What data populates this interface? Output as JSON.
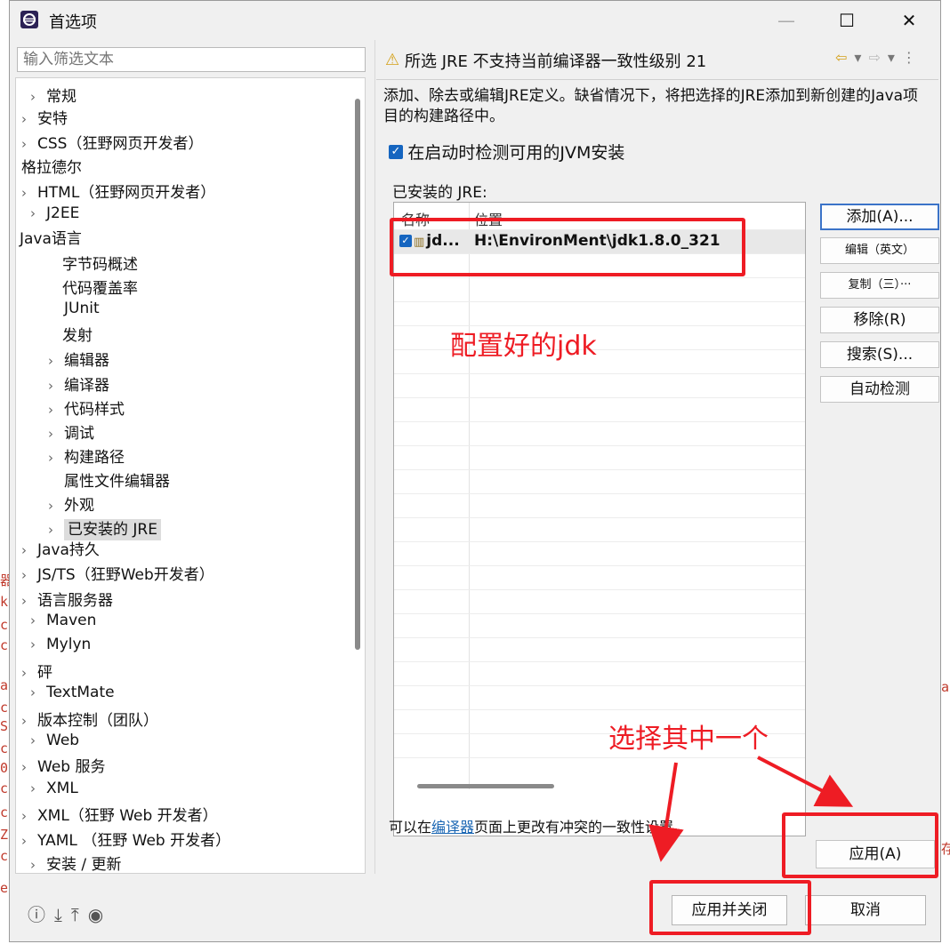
{
  "window": {
    "title": "首选项",
    "minimize": "—",
    "maximize": "☐",
    "close": "✕"
  },
  "filter": {
    "placeholder": "输入筛选文本"
  },
  "tree": {
    "items": [
      {
        "label": "常规",
        "chevron": true
      },
      {
        "label": "安特",
        "chevron": true
      },
      {
        "label": "CSS（狂野网页开发者）",
        "chevron": true
      },
      {
        "label": "格拉德尔",
        "chevron": false
      },
      {
        "label": "HTML（狂野网页开发者）",
        "chevron": true
      },
      {
        "label": "J2EE",
        "chevron": true
      },
      {
        "label": "Java语言",
        "chevron": false
      },
      {
        "label": "字节码概述",
        "chevron": false
      },
      {
        "label": "代码覆盖率",
        "chevron": false
      },
      {
        "label": "JUnit",
        "chevron": false
      },
      {
        "label": "发射",
        "chevron": false
      },
      {
        "label": "编辑器",
        "chevron": true
      },
      {
        "label": "编译器",
        "chevron": true
      },
      {
        "label": "代码样式",
        "chevron": true
      },
      {
        "label": "调试",
        "chevron": true
      },
      {
        "label": "构建路径",
        "chevron": true
      },
      {
        "label": "属性文件编辑器",
        "chevron": false
      },
      {
        "label": "外观",
        "chevron": true
      },
      {
        "label": "已安装的 JRE",
        "chevron": true
      },
      {
        "label": "Java持久",
        "chevron": true
      },
      {
        "label": "JS/TS（狂野Web开发者）",
        "chevron": true
      },
      {
        "label": "语言服务器",
        "chevron": true
      },
      {
        "label": "Maven",
        "chevron": true
      },
      {
        "label": "Mylyn",
        "chevron": true
      },
      {
        "label": "砰",
        "chevron": true
      },
      {
        "label": "TextMate",
        "chevron": true
      },
      {
        "label": "版本控制（团队）",
        "chevron": true
      },
      {
        "label": "Web",
        "chevron": true
      },
      {
        "label": "Web 服务",
        "chevron": true
      },
      {
        "label": "XML",
        "chevron": true
      },
      {
        "label": "XML（狂野 Web 开发者）",
        "chevron": true
      },
      {
        "label": "YAML （狂野 Web 开发者）",
        "chevron": true
      },
      {
        "label": "安装 / 更新",
        "chevron": true
      }
    ]
  },
  "page": {
    "header": "所选 JRE 不支持当前编译器一致性级别 21",
    "description": "添加、除去或编辑JRE定义。缺省情况下，将把选择的JRE添加到新创建的Java项目的构建路径中。",
    "detect_checkbox_label": "在启动时检测可用的JVM安装",
    "detect_checked": true,
    "installed_label": "已安装的 JRE:",
    "table": {
      "columns": [
        "名称",
        "位置"
      ],
      "rows": [
        {
          "name": "jd...",
          "location": "H:\\EnvironMent\\jdk1.8.0_321",
          "checked": true
        }
      ]
    },
    "buttons": {
      "add": "添加(A)...",
      "edit": "编辑（英文）",
      "copy": "复制（三）···",
      "remove": "移除(R)",
      "search": "搜索(S)...",
      "autodetect": "自动检测"
    },
    "footer_prefix": "可以在",
    "footer_link": "编译器",
    "footer_suffix": "页面上更改有冲突的一致性设置。",
    "apply": "应用(A)"
  },
  "bottom": {
    "apply_close": "应用并关闭",
    "cancel": "取消"
  },
  "annotations": {
    "configured_text": "配置好的jdk",
    "choose_text": "选择其中一个",
    "color": "#ee1c24"
  },
  "background_fragments": {
    "left": [
      "器",
      "ke",
      "c",
      "c",
      "a",
      "c",
      "Se",
      "c",
      "0",
      "c",
      "c",
      "Z:",
      "c",
      "en"
    ],
    "right": [
      "aD",
      "存"
    ]
  }
}
